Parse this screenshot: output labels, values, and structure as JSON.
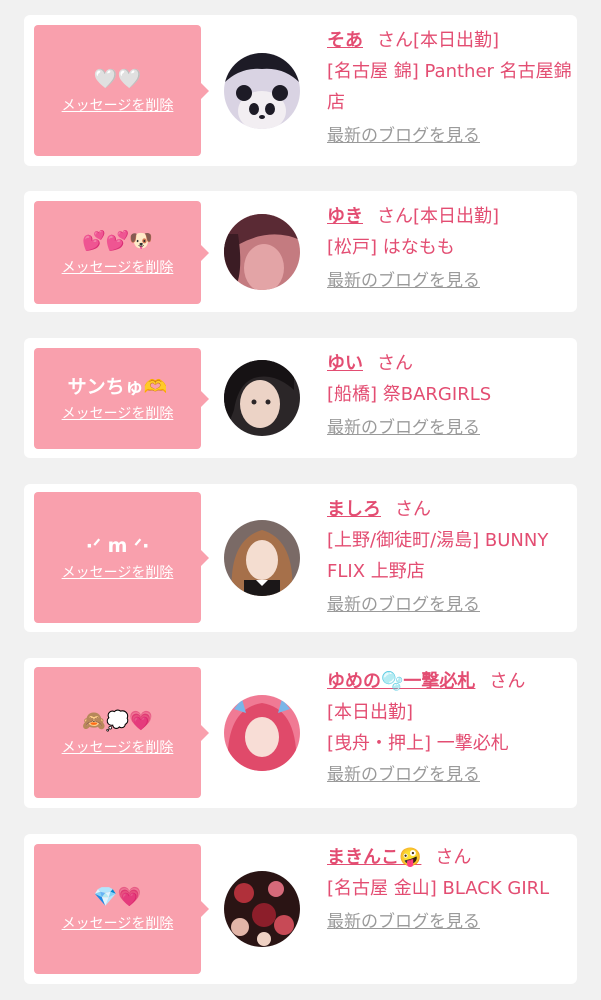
{
  "delete_label": "メッセージを削除",
  "blog_label": "最新のブログを見る",
  "san_label": "さん",
  "accent_color": "#e34d72",
  "bubble_color": "#f9a0ad",
  "cards": [
    {
      "message": "🤍🤍",
      "name": "そあ",
      "status": "[本日出勤]",
      "shop": "[名古屋 錦] Panther 名古屋錦店",
      "avatar": "panda-avatar"
    },
    {
      "message": "💕💕🐶",
      "name": "ゆき",
      "status": "[本日出勤]",
      "shop": "[松戸] はなもも",
      "avatar": "girl-avatar"
    },
    {
      "message": "サンちゅ🫶",
      "name": "ゆい",
      "status": "",
      "shop": "[船橋] 祭BARGIRLS",
      "avatar": "girl-avatar"
    },
    {
      "message": "·ᐟ m ᐟ·",
      "name": "ましろ",
      "status": "",
      "shop": "[上野/御徒町/湯島] BUNNY FLIX 上野店",
      "avatar": "girl-avatar"
    },
    {
      "message": "🙈💭💗",
      "name": "ゆめの🫧一撃必札",
      "status": "",
      "status_line": "[本日出勤]",
      "shop": "[曳舟・押上] 一撃必札",
      "avatar": "girl-avatar"
    },
    {
      "message": "💎💗",
      "name": "まきんこ🤪",
      "status": "",
      "shop": "[名古屋 金山] BLACK GIRL",
      "avatar": "flowers-avatar"
    }
  ]
}
